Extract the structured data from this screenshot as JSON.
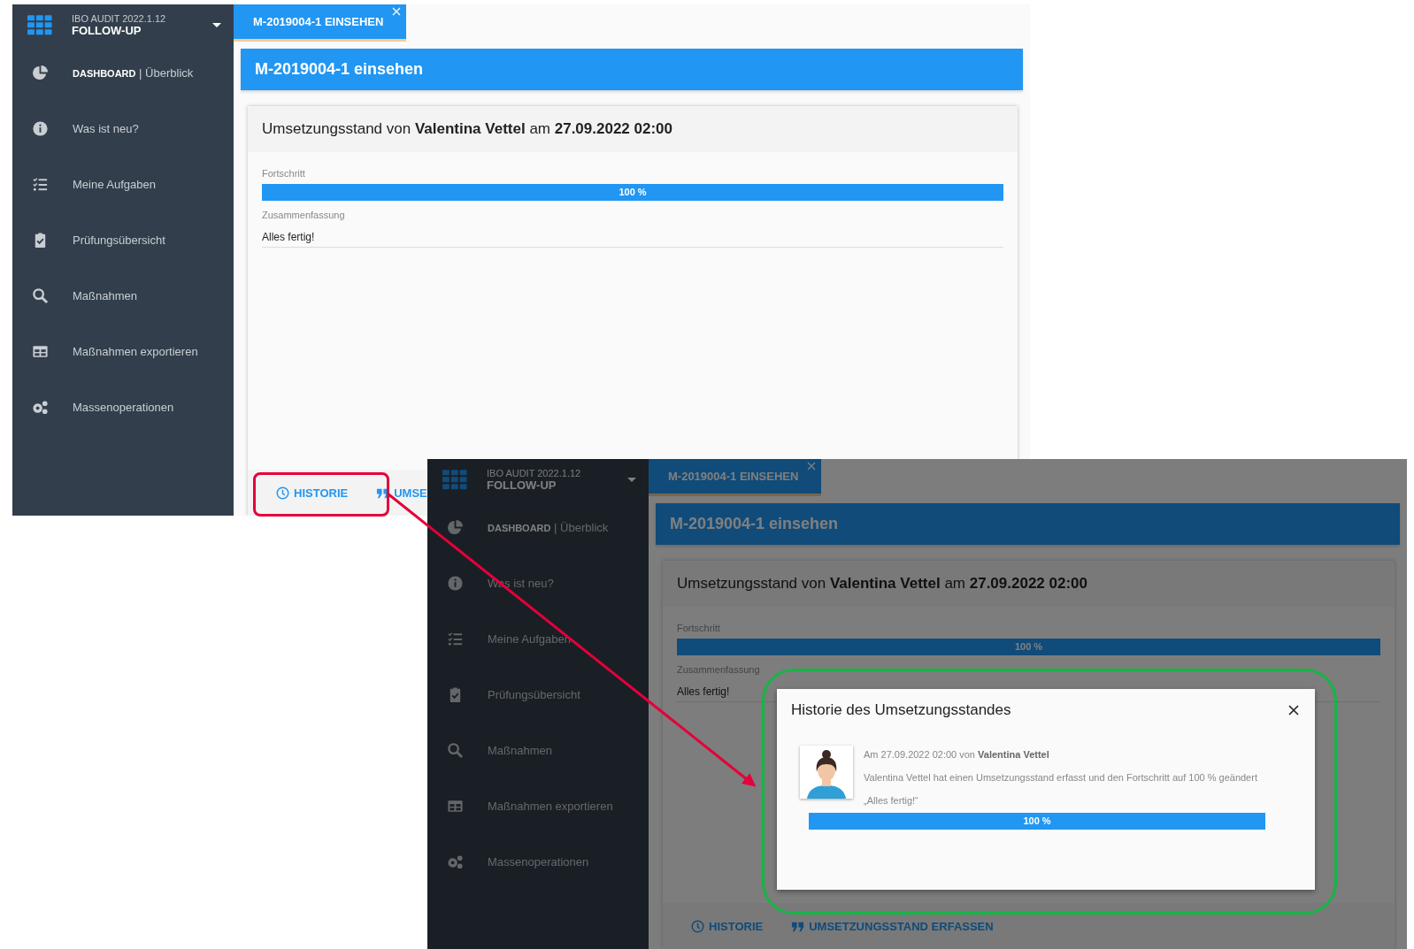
{
  "screenshots": [
    {
      "overlay": false,
      "app": {
        "version": "IBO AUDIT 2022.1.12",
        "module": "FOLLOW-UP"
      },
      "sidebar": {
        "items": [
          {
            "label": "**DASHBOARD** | Überblick"
          },
          {
            "label": "Was ist neu?"
          },
          {
            "label": "Meine Aufgaben"
          },
          {
            "label": "Prüfungsübersicht"
          },
          {
            "label": "Maßnahmen"
          },
          {
            "label": "Maßnahmen exportieren"
          },
          {
            "label": "Massenoperationen"
          }
        ]
      },
      "tabs": [
        {
          "label": "M-2019004-1 EINSEHEN",
          "selected": true
        }
      ],
      "page_title": "M-2019004-1 einsehen",
      "card": {
        "title": "Umsetzungsstand von **Valentina Vettel** am **27.09.2022 02:00**",
        "fields": [
          {
            "kind": "progress",
            "label": "Fortschritt",
            "level": 1,
            "reading": "100 %"
          },
          {
            "kind": "text",
            "label": "Zusammenfassung",
            "value": "Alles fertig!"
          }
        ],
        "buttons": [
          "HISTORIE",
          "UMSE"
        ]
      }
    },
    {
      "overlay": true,
      "app": {
        "version": "IBO AUDIT 2022.1.12",
        "module": "FOLLOW-UP"
      },
      "sidebar": {
        "items": [
          {
            "label": "**DASHBOARD** | Überblick"
          },
          {
            "label": "Was ist neu?"
          },
          {
            "label": "Meine Aufgaben"
          },
          {
            "label": "Prüfungsübersicht"
          },
          {
            "label": "Maßnahmen"
          },
          {
            "label": "Maßnahmen exportieren"
          },
          {
            "label": "Massenoperationen"
          }
        ]
      },
      "tabs": [
        {
          "label": "M-2019004-1 EINSEHEN",
          "selected": true
        }
      ],
      "page_title": "M-2019004-1 einsehen",
      "card": {
        "title": "Umsetzungsstand von **Valentina Vettel** am **27.09.2022 02:00**",
        "fields": [
          {
            "kind": "progress",
            "label": "Fortschritt",
            "level": 1,
            "reading": "100 %"
          },
          {
            "kind": "text",
            "label": "Zusammenfassung",
            "value": "Alles fertig!"
          }
        ],
        "buttons": [
          "HISTORIE",
          "UMSETZUNGSSTAND ERFASSEN"
        ]
      },
      "dialog": {
        "title": "Historie des Umsetzungsstandes",
        "entries": [
          {
            "meta": "Am 27.09.2022 02:00 von **Valentina Vettel**",
            "text": "Valentina Vettel hat einen Umsetzungsstand erfasst und den Fortschritt auf 100 % geändert",
            "quote": "„Alles fertig!“",
            "level": 1,
            "reading": "100 %"
          }
        ]
      }
    }
  ],
  "annotations": [
    {
      "kind": "box",
      "color": "#e4003a"
    },
    {
      "kind": "arrow",
      "color": "#e4003a"
    },
    {
      "kind": "box",
      "color": "#16b545"
    }
  ]
}
